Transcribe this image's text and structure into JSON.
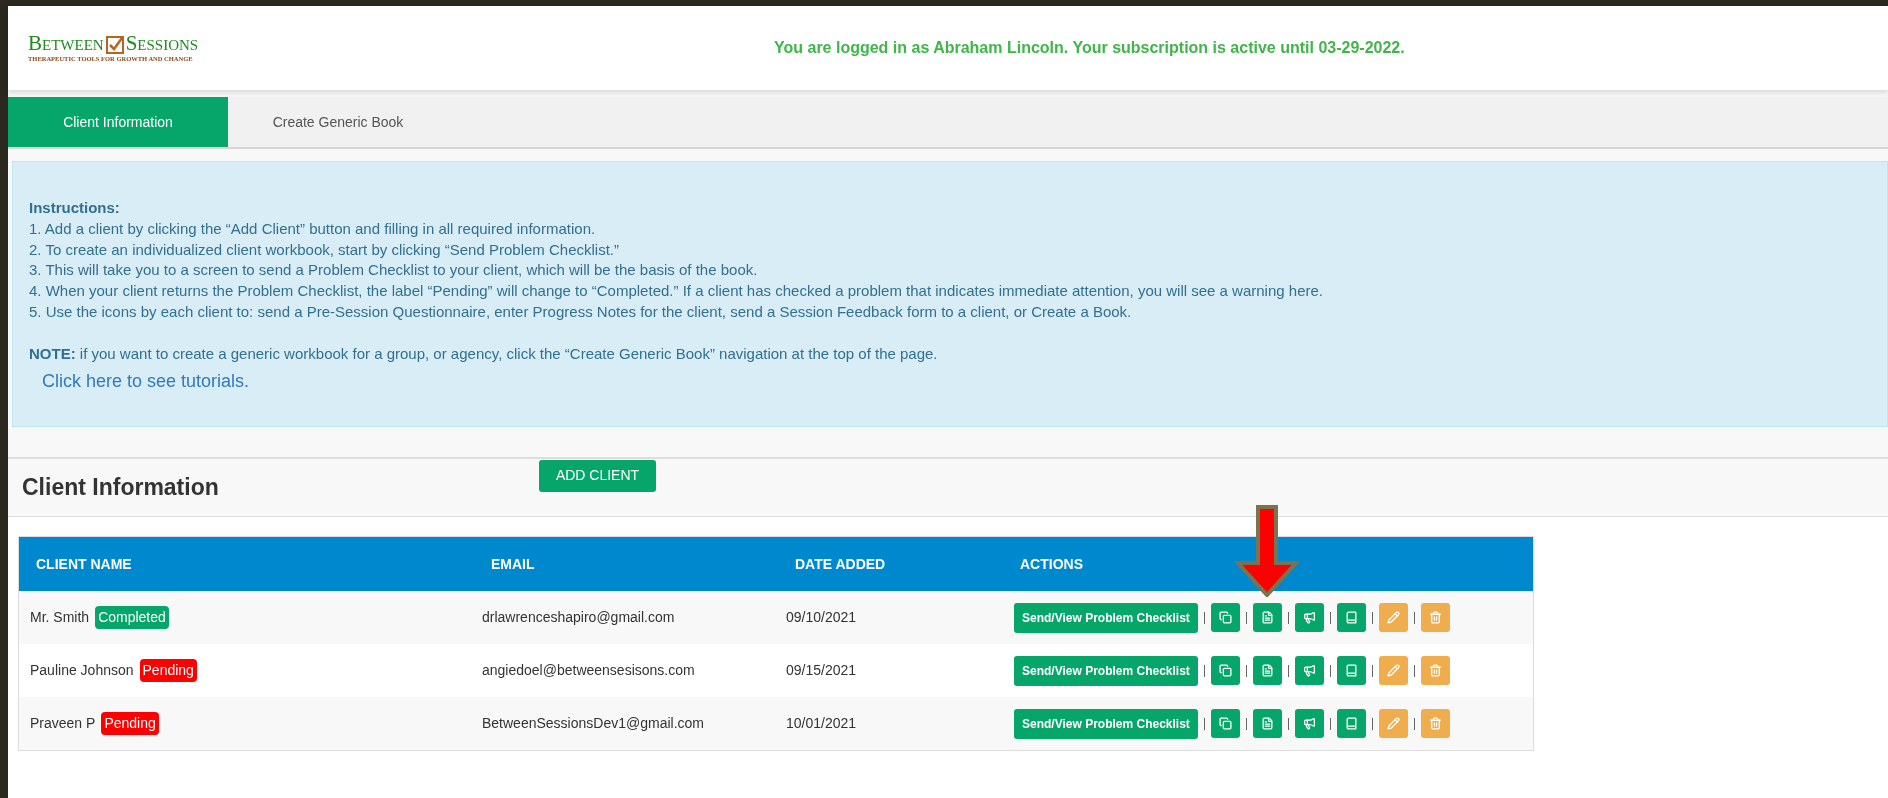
{
  "header": {
    "logo": {
      "word_1": "BETWEEN",
      "word_2": "SESSIONS",
      "tagline": "THERAPEUTIC TOOLS FOR GROWTH AND CHANGE"
    },
    "message": "You are logged in as Abraham Lincoln. Your subscription is active until 03-29-2022."
  },
  "tabs": [
    {
      "label": "Client Information",
      "selected": true
    },
    {
      "label": "Create Generic Book",
      "selected": false
    }
  ],
  "instructions": {
    "title": "Instructions:",
    "lines": [
      "1. Add a client by clicking the “Add Client” button and filling in all required information.",
      "2. To create an individualized client workbook, start by clicking “Send Problem Checklist.”",
      "3. This will take you to a screen to send a Problem Checklist to your client, which will be the basis of the book.",
      "4. When your client returns the Problem Checklist, the label “Pending” will change to “Completed.” If a client has checked a problem that indicates immediate attention, you will see a warning here.",
      "5. Use the icons by each client to: send a Pre-Session Questionnaire, enter Progress Notes for the client, send a Session Feedback form to a client, or Create a Book."
    ],
    "note": "**NOTE:** if you want to create a generic workbook for a group, or agency, click the “Create Generic Book” navigation at the top of the page.",
    "link": "Click here to see tutorials."
  },
  "section": {
    "title": "Client Information",
    "add_button": "ADD CLIENT"
  },
  "table": {
    "columns": [
      "CLIENT NAME",
      "EMAIL",
      "DATE ADDED",
      "ACTIONS"
    ],
    "rows": [
      {
        "name": "Mr. Smith",
        "status": {
          "label": "Completed",
          "kind": "completed"
        },
        "email": "drlawrenceshapiro@gmail.com",
        "date": "09/10/2021",
        "action": "Send/View Problem Checklist"
      },
      {
        "name": "Pauline Johnson",
        "status": {
          "label": "Pending",
          "kind": "pending"
        },
        "email": "angiedoel@betweensesisons.com",
        "date": "09/15/2021",
        "action": "Send/View Problem Checklist"
      },
      {
        "name": "Praveen P",
        "status": {
          "label": "Pending",
          "kind": "pending"
        },
        "email": "BetweenSessionsDev1@gmail.com",
        "date": "10/01/2021",
        "action": "Send/View Problem Checklist"
      }
    ]
  }
}
